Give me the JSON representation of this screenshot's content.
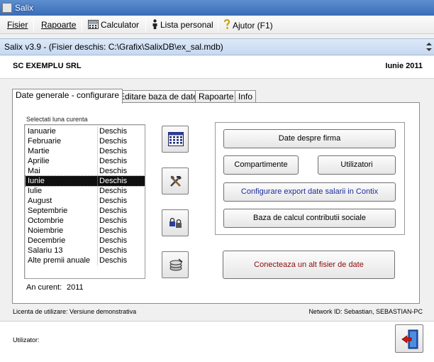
{
  "window": {
    "title": "Salix"
  },
  "menu": {
    "fisier": "Fisier",
    "rapoarte": "Rapoarte",
    "calculator": "Calculator",
    "lista_personal": "Lista personal",
    "ajutor": "Ajutor (F1)"
  },
  "subtitle": "Salix v3.9 - (Fisier deschis: C:\\Grafix\\SalixDB\\ex_sal.mdb)",
  "header": {
    "company": "SC EXEMPLU SRL",
    "period": "Iunie 2011"
  },
  "tabs": [
    {
      "label": "Date generale - configurare",
      "active": true
    },
    {
      "label": "Editare baza de date",
      "active": false
    },
    {
      "label": "Rapoarte",
      "active": false
    },
    {
      "label": "Info",
      "active": false
    }
  ],
  "month_list": {
    "caption": "Selectati luna curenta",
    "rows": [
      {
        "name": "Ianuarie",
        "status": "Deschis"
      },
      {
        "name": "Februarie",
        "status": "Deschis"
      },
      {
        "name": "Martie",
        "status": "Deschis"
      },
      {
        "name": "Aprilie",
        "status": "Deschis"
      },
      {
        "name": "Mai",
        "status": "Deschis"
      },
      {
        "name": "Iunie",
        "status": "Deschis",
        "selected": true
      },
      {
        "name": "Iulie",
        "status": "Deschis"
      },
      {
        "name": "August",
        "status": "Deschis"
      },
      {
        "name": "Septembrie",
        "status": "Deschis"
      },
      {
        "name": "Octombrie",
        "status": "Deschis"
      },
      {
        "name": "Noiembrie",
        "status": "Deschis"
      },
      {
        "name": "Decembrie",
        "status": "Deschis"
      },
      {
        "name": "Salariu 13",
        "status": "Deschis"
      },
      {
        "name": "Alte premii anuale",
        "status": "Deschis"
      }
    ]
  },
  "current_year": {
    "label": "An curent:",
    "value": "2011"
  },
  "side_icons": [
    "calendar-grid-icon",
    "tools-icon",
    "lock-keys-icon",
    "coins-icon"
  ],
  "buttons": {
    "firma": "Date despre firma",
    "compartimente": "Compartimente",
    "utilizatori": "Utilizatori",
    "export": "Configurare export date salarii in Contix",
    "baza_calcul": "Baza de calcul contributii sociale",
    "conecteaza": "Conecteaza un alt fisier de date"
  },
  "footer": {
    "license": "Licenta de utilizare: Versiune demonstrativa",
    "network": "Network ID: Sebastian, SEBASTIAN-PC"
  },
  "user": {
    "label": "Utilizator:"
  },
  "colors": {
    "title_bar": "#3a6cb7",
    "selected_row": "#0f0f0f",
    "link_blue": "#1b2c9e",
    "link_red": "#8c0c0c"
  }
}
